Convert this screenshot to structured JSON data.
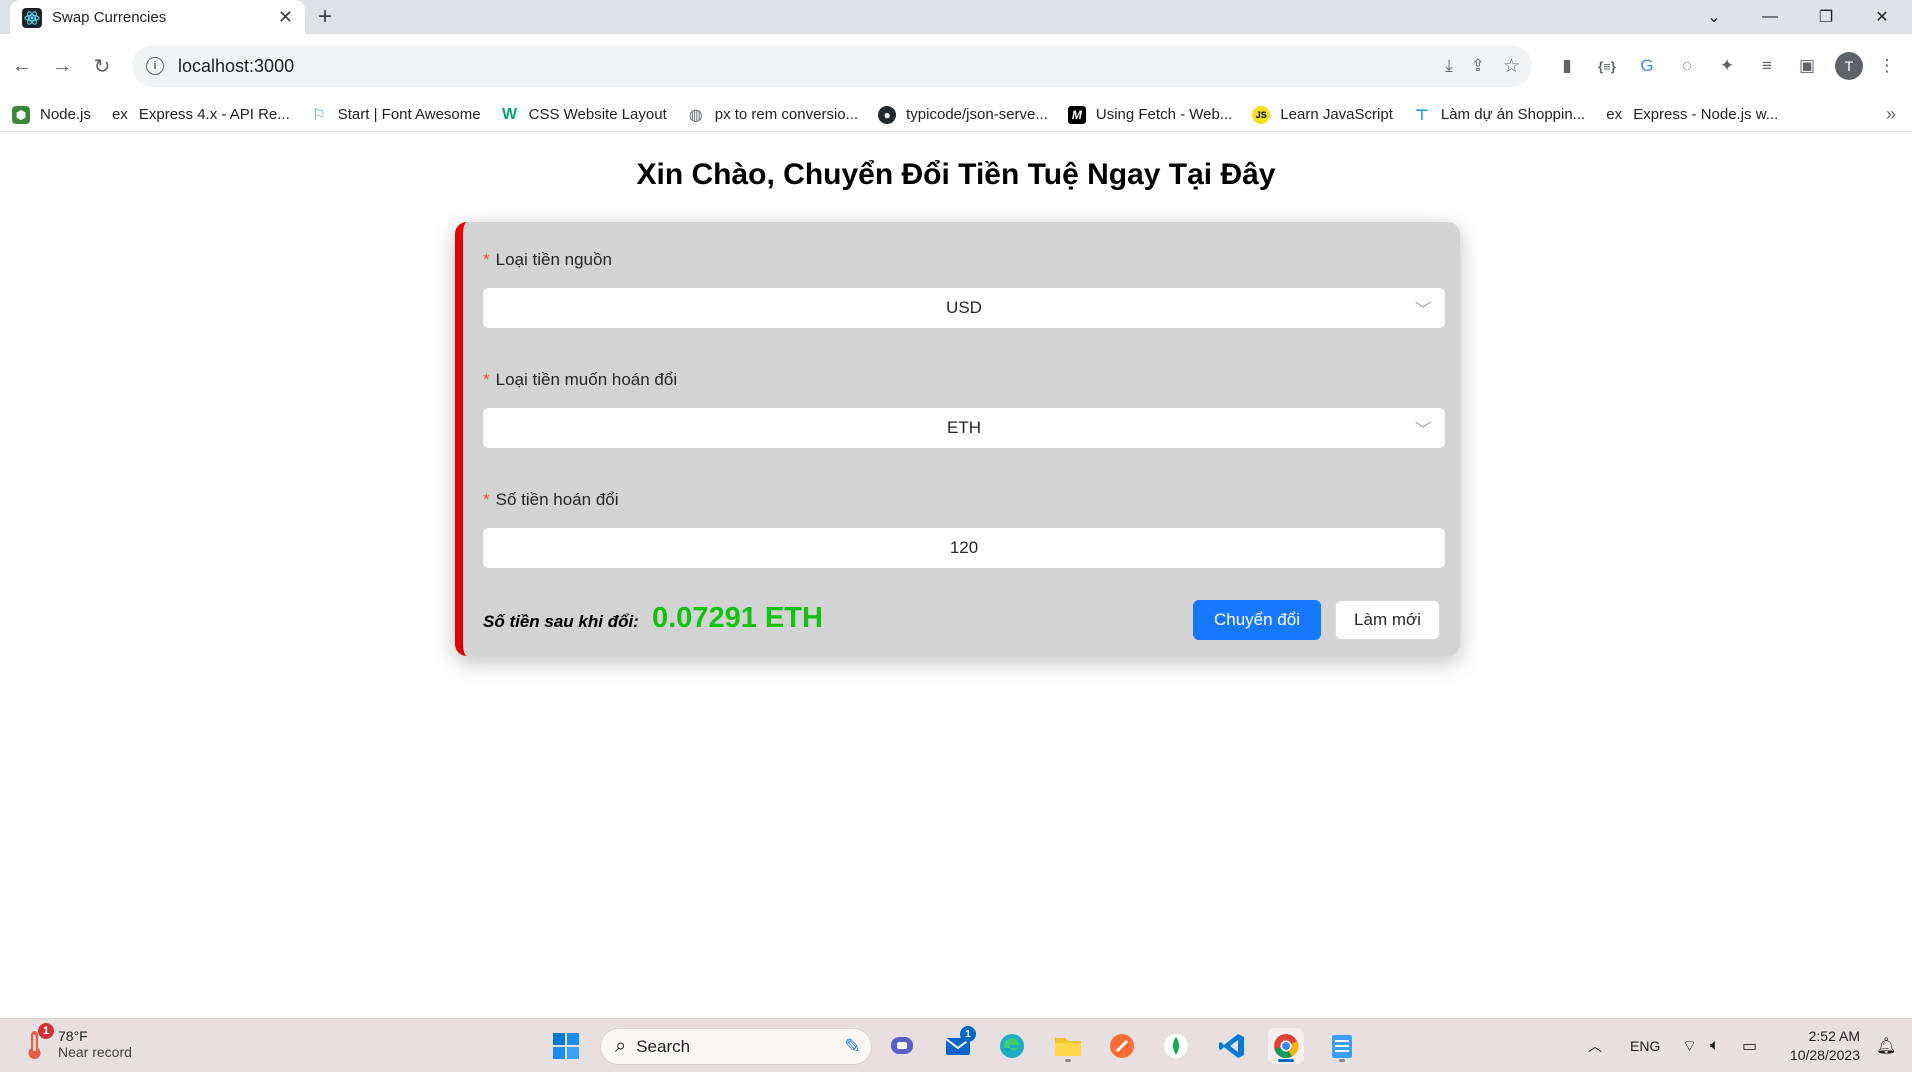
{
  "browser": {
    "tab_title": "Swap Currencies",
    "url": "localhost:3000",
    "profile_initial": "T",
    "bookmarks": [
      {
        "label": "Node.js",
        "icon": "nodejs-icon"
      },
      {
        "label": "Express 4.x - API Re...",
        "icon": "express-icon"
      },
      {
        "label": "Start | Font Awesome",
        "icon": "flag-icon"
      },
      {
        "label": "CSS Website Layout",
        "icon": "w3schools-icon"
      },
      {
        "label": "px to rem conversio...",
        "icon": "globe-icon"
      },
      {
        "label": "typicode/json-serve...",
        "icon": "github-icon"
      },
      {
        "label": "Using Fetch - Web...",
        "icon": "mdn-icon"
      },
      {
        "label": "Learn JavaScript",
        "icon": "js-icon"
      },
      {
        "label": "Làm dự án Shoppin...",
        "icon": "pin-icon"
      },
      {
        "label": "Express - Node.js w...",
        "icon": "express-icon"
      }
    ]
  },
  "page": {
    "heading": "Xin Chào, Chuyển Đổi Tiền Tuệ Ngay Tại Đây",
    "form": {
      "source_label": "Loại tiền nguồn",
      "source_value": "USD",
      "target_label": "Loại tiền muốn hoán đổi",
      "target_value": "ETH",
      "amount_label": "Số tiền hoán đổi",
      "amount_value": "120",
      "required_mark": "*"
    },
    "result": {
      "label": "Số tiền sau khi đổi:",
      "value": "0.07291 ETH"
    },
    "buttons": {
      "convert": "Chuyển đổi",
      "reset": "Làm mới"
    },
    "colors": {
      "accent_border": "#e00000",
      "result_green": "#11c211",
      "primary_button": "#1677ff"
    }
  },
  "taskbar": {
    "weather_badge": "1",
    "temperature": "78°F",
    "weather_desc": "Near record",
    "search_label": "Search",
    "mail_badge": "1",
    "language": "ENG",
    "time": "2:52 AM",
    "date": "10/28/2023"
  }
}
